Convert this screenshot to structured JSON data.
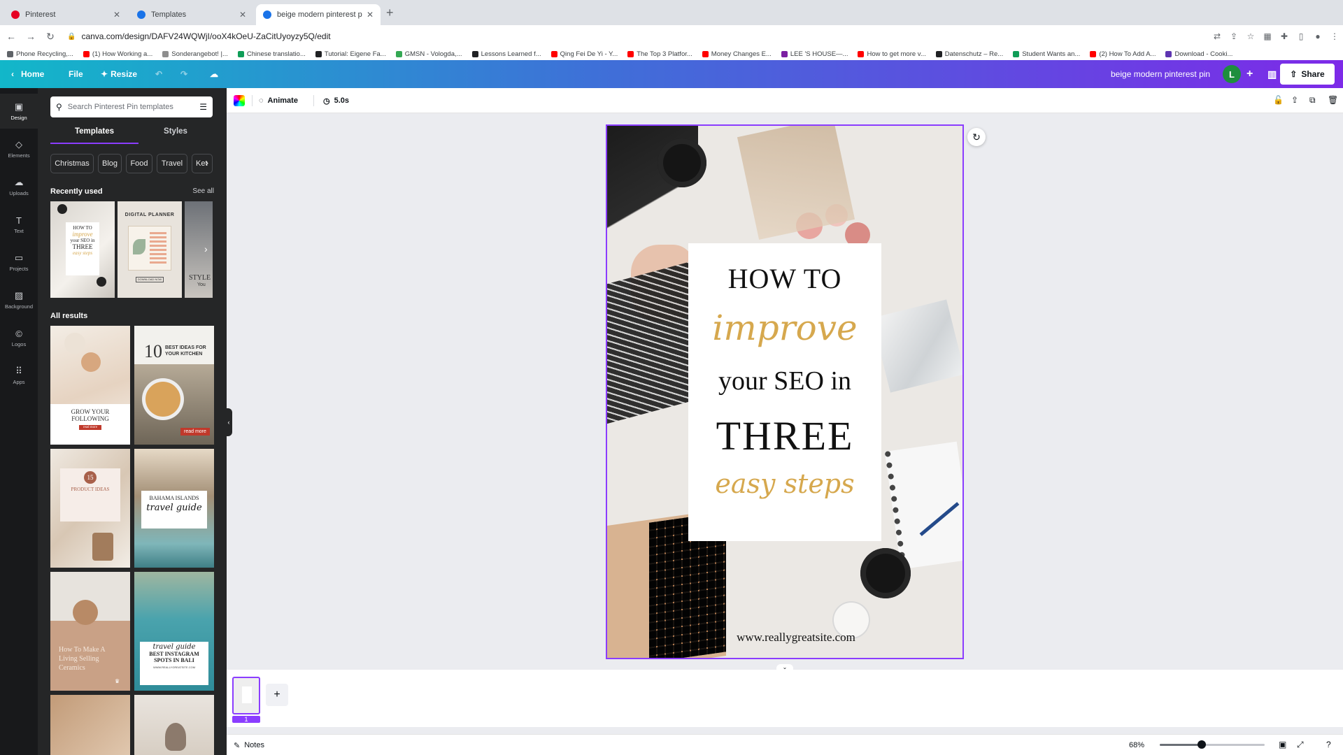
{
  "browser": {
    "tabs": [
      {
        "title": "Pinterest",
        "color": "#e60023"
      },
      {
        "title": "Templates",
        "color": "#1a73e8"
      },
      {
        "title": "beige modern pinterest pin - P",
        "color": "#1a73e8"
      }
    ],
    "url": "canva.com/design/DAFV24WQWjI/ooX4kOeU-ZaCitUyoyzy5Q/edit",
    "bookmarks": [
      {
        "label": "Phone Recycling,...",
        "color": "#5f6368"
      },
      {
        "label": "(1) How Working a...",
        "color": "#ff0000"
      },
      {
        "label": "Sonderangebot! |...",
        "color": "#8e8e8e"
      },
      {
        "label": "Chinese translatio...",
        "color": "#0f9d58"
      },
      {
        "label": "Tutorial: Eigene Fa...",
        "color": "#202124"
      },
      {
        "label": "GMSN - Vologda,...",
        "color": "#34a853"
      },
      {
        "label": "Lessons Learned f...",
        "color": "#202124"
      },
      {
        "label": "Qing Fei De Yi - Y...",
        "color": "#ff0000"
      },
      {
        "label": "The Top 3 Platfor...",
        "color": "#ff0000"
      },
      {
        "label": "Money Changes E...",
        "color": "#ff0000"
      },
      {
        "label": "LEE 'S HOUSE—...",
        "color": "#7b1fa2"
      },
      {
        "label": "How to get more v...",
        "color": "#ff0000"
      },
      {
        "label": "Datenschutz – Re...",
        "color": "#202124"
      },
      {
        "label": "Student Wants an...",
        "color": "#0f9d58"
      },
      {
        "label": "(2) How To Add A...",
        "color": "#ff0000"
      },
      {
        "label": "Download - Cooki...",
        "color": "#5e35b1"
      }
    ]
  },
  "header": {
    "home": "Home",
    "file": "File",
    "resize": "Resize",
    "design_title": "beige modern pinterest pin",
    "avatar_letter": "L",
    "share": "Share"
  },
  "rail": [
    {
      "label": "Design",
      "icon": "▣"
    },
    {
      "label": "Elements",
      "icon": "◇"
    },
    {
      "label": "Uploads",
      "icon": "☁"
    },
    {
      "label": "Text",
      "icon": "T"
    },
    {
      "label": "Projects",
      "icon": "▭"
    },
    {
      "label": "Background",
      "icon": "▨"
    },
    {
      "label": "Logos",
      "icon": "©"
    },
    {
      "label": "Apps",
      "icon": "⠿"
    }
  ],
  "panel": {
    "search_placeholder": "Search Pinterest Pin templates",
    "tabs": [
      "Templates",
      "Styles"
    ],
    "chips": [
      "Christmas",
      "Blog",
      "Food",
      "Travel",
      "Ket"
    ],
    "recently_used": "Recently used",
    "see_all": "See all",
    "all_results": "All results",
    "recent_thumbs": [
      {
        "lines": [
          "HOW TO",
          "improve",
          "your SEO in",
          "THREE",
          "easy steps"
        ]
      },
      {
        "lines": [
          "DIGITAL PLANNER",
          "DOWNLOAD NOW"
        ]
      },
      {
        "lines": [
          "STYLE",
          "You"
        ]
      }
    ],
    "results": [
      {
        "lines": [
          "GROW YOUR",
          "FOLLOWING",
          "read more"
        ]
      },
      {
        "lines": [
          "10",
          "BEST IDEAS FOR",
          "YOUR KITCHEN",
          "read more"
        ]
      },
      {
        "lines": [
          "15",
          "PRODUCT IDEAS"
        ]
      },
      {
        "lines": [
          "BAHAMA ISLANDS",
          "travel guide"
        ]
      },
      {
        "lines": [
          "How To Make A",
          "Living Selling",
          "Ceramics"
        ]
      },
      {
        "lines": [
          "travel guide",
          "BEST INSTAGRAM",
          "SPOTS IN BALI",
          "WWW.REALLYGREATSITE.COM"
        ]
      }
    ]
  },
  "toolbar": {
    "animate": "Animate",
    "duration": "5.0s"
  },
  "design": {
    "line1": "HOW TO",
    "line2": "improve",
    "line3": "your SEO in",
    "line4": "THREE",
    "line5": "easy steps",
    "website": "www.reallygreatsite.com",
    "accent": "#d6a84e"
  },
  "pages": {
    "number": "1",
    "notes": "Notes",
    "zoom": "68%",
    "zoom_level": 0.4
  }
}
